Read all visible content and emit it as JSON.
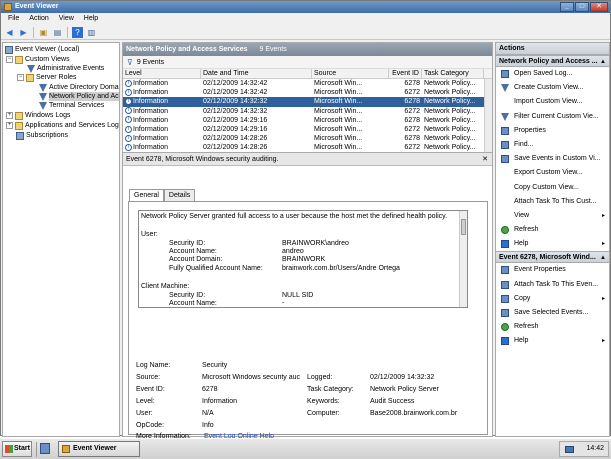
{
  "window": {
    "title": "Event Viewer"
  },
  "menu": [
    "File",
    "Action",
    "View",
    "Help"
  ],
  "tree": {
    "items": [
      {
        "label": "Event Viewer (Local)",
        "exp": "−",
        "icon": "ev"
      },
      {
        "label": "Custom Views",
        "exp": "−",
        "icon": "folder"
      },
      {
        "label": "Administrative Events",
        "exp": "",
        "icon": "filter"
      },
      {
        "label": "Server Roles",
        "exp": "−",
        "icon": "folder"
      },
      {
        "label": "Active Directory Domain",
        "exp": "",
        "icon": "filter"
      },
      {
        "label": "Network Policy and Acc",
        "exp": "",
        "icon": "filter"
      },
      {
        "label": "Terminal Services",
        "exp": "",
        "icon": "filter"
      },
      {
        "label": "Windows Logs",
        "exp": "+",
        "icon": "folder"
      },
      {
        "label": "Applications and Services Logs",
        "exp": "+",
        "icon": "folder"
      },
      {
        "label": "Subscriptions",
        "exp": "",
        "icon": "ev"
      }
    ]
  },
  "center": {
    "title": "Network Policy and Access Services",
    "count": "9 Events",
    "filter_count": "9 Events",
    "columns": [
      "Level",
      "Date and Time",
      "Source",
      "Event ID",
      "Task Category"
    ],
    "rows": [
      [
        "Information",
        "02/12/2009 14:32:42",
        "Microsoft Win...",
        "6278",
        "Network Policy..."
      ],
      [
        "Information",
        "02/12/2009 14:32:42",
        "Microsoft Win...",
        "6272",
        "Network Policy..."
      ],
      [
        "Information",
        "02/12/2009 14:32:32",
        "Microsoft Win...",
        "6278",
        "Network Policy..."
      ],
      [
        "Information",
        "02/12/2009 14:32:32",
        "Microsoft Win...",
        "6272",
        "Network Policy..."
      ],
      [
        "Information",
        "02/12/2009 14:29:16",
        "Microsoft Win...",
        "6278",
        "Network Policy..."
      ],
      [
        "Information",
        "02/12/2009 14:29:16",
        "Microsoft Win...",
        "6272",
        "Network Policy..."
      ],
      [
        "Information",
        "02/12/2009 14:28:26",
        "Microsoft Win...",
        "6278",
        "Network Policy..."
      ],
      [
        "Information",
        "02/12/2009 14:28:26",
        "Microsoft Win...",
        "6272",
        "Network Policy..."
      ]
    ],
    "selected_row": 2
  },
  "detail": {
    "header": "Event 6278, Microsoft Windows security auditing.",
    "tabs": [
      "General",
      "Details"
    ],
    "message": {
      "intro": "Network Policy Server granted full access to a user because the host met the defined health policy.",
      "user_heading": "User:",
      "user_fields": [
        [
          "Security ID:",
          "BRAINWORK\\andreo"
        ],
        [
          "Account Name:",
          "andreo"
        ],
        [
          "Account Domain:",
          "BRAINWORK"
        ],
        [
          "Fully Qualified Account Name:",
          "brainwork.com.br/Users/Andre Ortega"
        ]
      ],
      "client_heading": "Client Machine:",
      "client_fields": [
        [
          "Security ID:",
          "NULL SID"
        ],
        [
          "Account Name:",
          "-"
        ]
      ]
    },
    "props": {
      "log_name_label": "Log Name:",
      "log_name": "Security",
      "source_label": "Source:",
      "source": "Microsoft Windows security auc",
      "logged_label": "Logged:",
      "logged": "02/12/2009 14:32:32",
      "event_id_label": "Event ID:",
      "event_id": "6278",
      "task_cat_label": "Task Category:",
      "task_cat": "Network Policy Server",
      "level_label": "Level:",
      "level": "Information",
      "keywords_label": "Keywords:",
      "keywords": "Audit Success",
      "user_label": "User:",
      "user": "N/A",
      "computer_label": "Computer:",
      "computer": "Base2008.brainwork.com.br",
      "opcode_label": "OpCode:",
      "opcode": "Info",
      "more_info_label": "More Information:",
      "more_info_link": "Event Log Online Help"
    }
  },
  "actions": {
    "title": "Actions",
    "section1": "Network Policy and Access ...",
    "items1": [
      {
        "label": "Open Saved Log...",
        "icon": "blue",
        "arrow": ""
      },
      {
        "label": "Create Custom View...",
        "icon": "filter",
        "arrow": ""
      },
      {
        "label": "Import Custom View...",
        "icon": "none",
        "arrow": ""
      },
      {
        "label": "Filter Current Custom Vie...",
        "icon": "filter",
        "arrow": ""
      },
      {
        "label": "Properties",
        "icon": "blue",
        "arrow": ""
      },
      {
        "label": "Find...",
        "icon": "blue",
        "arrow": ""
      },
      {
        "label": "Save Events in Custom Vi...",
        "icon": "blue",
        "arrow": ""
      },
      {
        "label": "Export Custom View...",
        "icon": "none",
        "arrow": ""
      },
      {
        "label": "Copy Custom View...",
        "icon": "none",
        "arrow": ""
      },
      {
        "label": "Attach Task To This Cust...",
        "icon": "none",
        "arrow": ""
      },
      {
        "label": "View",
        "icon": "none",
        "arrow": "▸"
      },
      {
        "label": "Refresh",
        "icon": "green",
        "arrow": ""
      },
      {
        "label": "Help",
        "icon": "help",
        "arrow": "▸"
      }
    ],
    "section2": "Event 6278, Microsoft Wind...",
    "items2": [
      {
        "label": "Event Properties",
        "icon": "blue",
        "arrow": ""
      },
      {
        "label": "Attach Task To This Even...",
        "icon": "blue",
        "arrow": ""
      },
      {
        "label": "Copy",
        "icon": "blue",
        "arrow": "▸"
      },
      {
        "label": "Save Selected Events...",
        "icon": "blue",
        "arrow": ""
      },
      {
        "label": "Refresh",
        "icon": "green",
        "arrow": ""
      },
      {
        "label": "Help",
        "icon": "help",
        "arrow": "▸"
      }
    ]
  },
  "taskbar": {
    "start": "Start",
    "task": "Event Viewer",
    "clock": "14:42"
  }
}
